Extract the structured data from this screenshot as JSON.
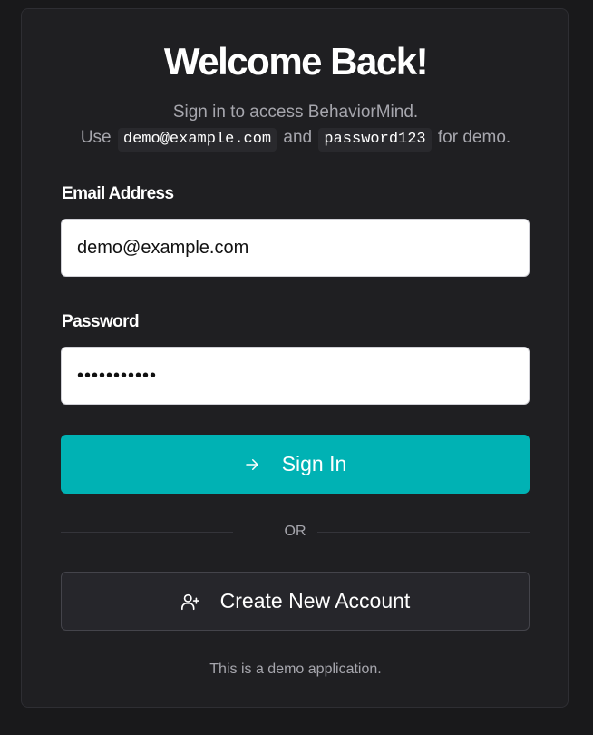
{
  "login": {
    "title": "Welcome Back!",
    "subtitle": "Sign in to access BehaviorMind.",
    "hint_prefix": "Use",
    "hint_email": "demo@example.com",
    "hint_and": "and",
    "hint_password": "password123",
    "hint_suffix": "for demo.",
    "email_label": "Email Address",
    "email_value": "demo@example.com",
    "password_label": "Password",
    "password_value": "password123",
    "sign_in_label": "Sign In",
    "sign_in_icon": "arrow-right-icon",
    "divider_text": "OR",
    "create_account_label": "Create New Account",
    "create_account_icon": "user-plus-icon",
    "footer_note": "This is a demo application."
  },
  "colors": {
    "page_background": "#19191b",
    "card_background": "#1f1f22",
    "primary_button": "#00b2b4",
    "secondary_button": "#26262b",
    "muted_text": "#a6a6ad"
  }
}
